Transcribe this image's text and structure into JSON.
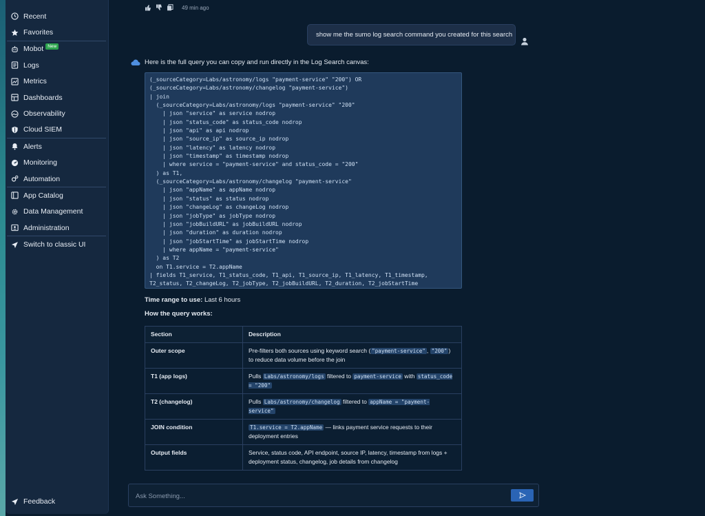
{
  "sidebar": {
    "items": [
      {
        "label": "Recent",
        "icon": "clock-icon"
      },
      {
        "label": "Favorites",
        "icon": "star-icon"
      },
      {
        "label": "Mobot",
        "icon": "robot-icon",
        "badge": "New"
      },
      {
        "label": "Logs",
        "icon": "logs-icon"
      },
      {
        "label": "Metrics",
        "icon": "metrics-icon"
      },
      {
        "label": "Dashboards",
        "icon": "dashboard-icon"
      },
      {
        "label": "Observability",
        "icon": "observability-icon"
      },
      {
        "label": "Cloud SIEM",
        "icon": "shield-icon"
      },
      {
        "label": "Alerts",
        "icon": "bell-icon"
      },
      {
        "label": "Monitoring",
        "icon": "monitor-icon"
      },
      {
        "label": "Automation",
        "icon": "gears-icon"
      },
      {
        "label": "App Catalog",
        "icon": "catalog-icon"
      },
      {
        "label": "Data Management",
        "icon": "gear-icon"
      },
      {
        "label": "Administration",
        "icon": "admin-icon"
      },
      {
        "label": "Switch to classic UI",
        "icon": "rocket-icon"
      }
    ],
    "feedback": "Feedback"
  },
  "chat": {
    "prev_time": "49 min ago",
    "user_message": "show me the sumo log search command you created for this search",
    "bot_intro": "Here is the full query you can copy and run directly in the Log Search canvas:",
    "code": "(_sourceCategory=Labs/astronomy/logs \"payment-service\" \"200\") OR\n(_sourceCategory=Labs/astronomy/changelog \"payment-service\")\n| join\n  (_sourceCategory=Labs/astronomy/logs \"payment-service\" \"200\"\n    | json \"service\" as service nodrop\n    | json \"status_code\" as status_code nodrop\n    | json \"api\" as api nodrop\n    | json \"source_ip\" as source_ip nodrop\n    | json \"latency\" as latency nodrop\n    | json \"timestamp\" as timestamp nodrop\n    | where service = \"payment-service\" and status_code = \"200\"\n  ) as T1,\n  (_sourceCategory=Labs/astronomy/changelog \"payment-service\"\n    | json \"appName\" as appName nodrop\n    | json \"status\" as status nodrop\n    | json \"changeLog\" as changeLog nodrop\n    | json \"jobType\" as jobType nodrop\n    | json \"jobBuildURL\" as jobBuildURL nodrop\n    | json \"duration\" as duration nodrop\n    | json \"jobStartTime\" as jobStartTime nodrop\n    | where appName = \"payment-service\"\n  ) as T2\n  on T1.service = T2.appName\n| fields T1_service, T1_status_code, T1_api, T1_source_ip, T1_latency, T1_timestamp,\nT2_status, T2_changeLog, T2_jobType, T2_jobBuildURL, T2_duration, T2_jobStartTime",
    "time_range_label": "Time range to use:",
    "time_range_value": "Last 6 hours",
    "how_title": "How the query works:",
    "table": {
      "headers": [
        "Section",
        "Description"
      ],
      "rows": [
        {
          "section": "Outer scope",
          "parts": [
            {
              "t": "Pre-filters both sources using keyword search ("
            },
            {
              "c": "\"payment-service\""
            },
            {
              "t": ", "
            },
            {
              "c": "\"200\""
            },
            {
              "t": ") to reduce data volume before the join"
            }
          ]
        },
        {
          "section": "T1 (app logs)",
          "parts": [
            {
              "t": "Pulls "
            },
            {
              "c": "Labs/astronomy/logs"
            },
            {
              "t": " filtered to "
            },
            {
              "c": "payment-service"
            },
            {
              "t": " with "
            },
            {
              "c": "status_code = \"200\""
            }
          ]
        },
        {
          "section": "T2 (changelog)",
          "parts": [
            {
              "t": "Pulls "
            },
            {
              "c": "Labs/astronomy/changelog"
            },
            {
              "t": " filtered to "
            },
            {
              "c": "appName = \"payment-service\""
            }
          ]
        },
        {
          "section": "JOIN condition",
          "parts": [
            {
              "c": "T1.service = T2.appName"
            },
            {
              "t": " — links payment service requests to their deployment entries"
            }
          ]
        },
        {
          "section": "Output fields",
          "parts": [
            {
              "t": "Service, status code, API endpoint, source IP, latency, timestamp from logs + deployment status, changelog, job details from changelog"
            }
          ]
        }
      ]
    }
  },
  "input": {
    "placeholder": "Ask Something..."
  }
}
